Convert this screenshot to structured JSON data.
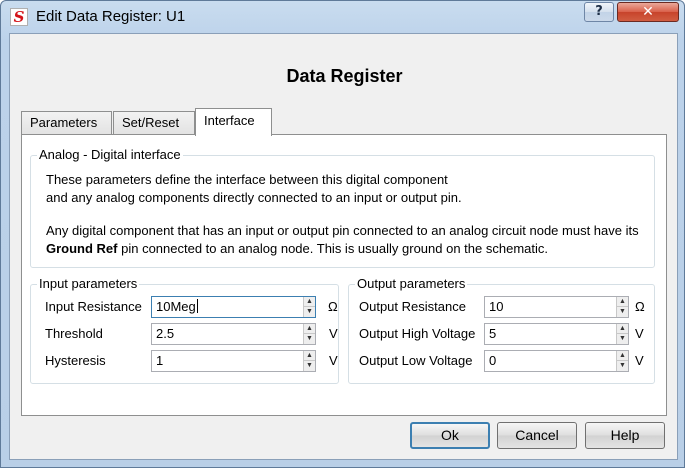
{
  "window": {
    "title": "Edit Data Register: U1",
    "help_button": "?",
    "close_button": "✕"
  },
  "dialog": {
    "heading": "Data Register"
  },
  "tabs": [
    {
      "label": "Parameters",
      "active": false
    },
    {
      "label": "Set/Reset",
      "active": false
    },
    {
      "label": "Interface",
      "active": true
    }
  ],
  "analog_group": {
    "legend": "Analog - Digital interface",
    "line1": "These parameters define the interface between this digital component",
    "line2": "and any analog components directly connected to an input or output pin.",
    "line3": "Any digital component that has an input or output pin connected to an analog circuit node must have its",
    "line4_bold": "Ground Ref",
    "line4_rest": " pin connected to an analog node. This is usually ground on the schematic."
  },
  "input_group": {
    "legend": "Input parameters",
    "rows": [
      {
        "label": "Input Resistance",
        "value": "10Meg",
        "unit": "Ω"
      },
      {
        "label": "Threshold",
        "value": "2.5",
        "unit": "V"
      },
      {
        "label": "Hysteresis",
        "value": "1",
        "unit": "V"
      }
    ]
  },
  "output_group": {
    "legend": "Output parameters",
    "rows": [
      {
        "label": "Output Resistance",
        "value": "10",
        "unit": "Ω"
      },
      {
        "label": "Output High Voltage",
        "value": "5",
        "unit": "V"
      },
      {
        "label": "Output Low Voltage",
        "value": "0",
        "unit": "V"
      }
    ]
  },
  "buttons": {
    "ok": "Ok",
    "cancel": "Cancel",
    "help": "Help"
  },
  "icons": {
    "app_icon_glyph": "S",
    "spin_up": "▲",
    "spin_down": "▼"
  }
}
